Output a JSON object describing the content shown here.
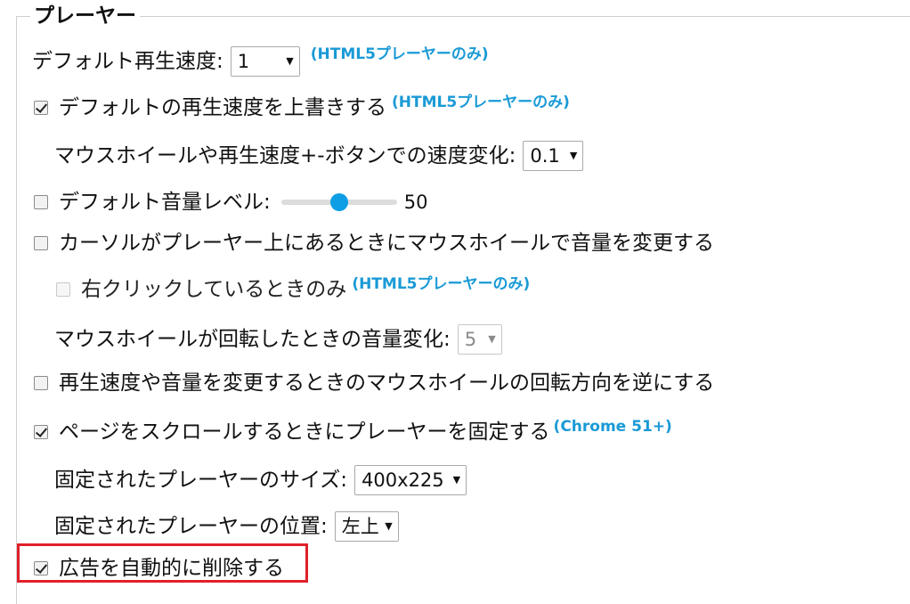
{
  "section": {
    "title": "プレーヤー"
  },
  "default_speed": {
    "label": "デフォルト再生速度:",
    "value": "1",
    "note": "(HTML5プレーヤーのみ)"
  },
  "override_speed": {
    "label": "デフォルトの再生速度を上書きする",
    "checked": true,
    "note": "(HTML5プレーヤーのみ)"
  },
  "speed_step": {
    "label": "マウスホイールや再生速度+-ボタンでの速度変化:",
    "value": "0.1"
  },
  "default_volume": {
    "label": "デフォルト音量レベル:",
    "checked": false,
    "value": "50",
    "level": 50
  },
  "wheel_volume": {
    "label": "カーソルがプレーヤー上にあるときにマウスホイールで音量を変更する",
    "checked": false
  },
  "right_click_only": {
    "label": "右クリックしているときのみ",
    "checked": false,
    "note": "(HTML5プレーヤーのみ)"
  },
  "volume_step": {
    "label": "マウスホイールが回転したときの音量変化:",
    "value": "5"
  },
  "reverse_wheel": {
    "label": "再生速度や音量を変更するときのマウスホイールの回転方向を逆にする",
    "checked": false
  },
  "pin_player": {
    "label": "ページをスクロールするときにプレーヤーを固定する",
    "checked": true,
    "note": "(Chrome 51+)"
  },
  "pinned_size": {
    "label": "固定されたプレーヤーのサイズ:",
    "value": "400x225"
  },
  "pinned_position": {
    "label": "固定されたプレーヤーの位置:",
    "value": "左上"
  },
  "remove_ads": {
    "label": "広告を自動的に削除する",
    "checked": true
  },
  "colors": {
    "accent": "#1a9ad6",
    "highlight": "#e0202a",
    "slider": "#0d9ee6"
  }
}
